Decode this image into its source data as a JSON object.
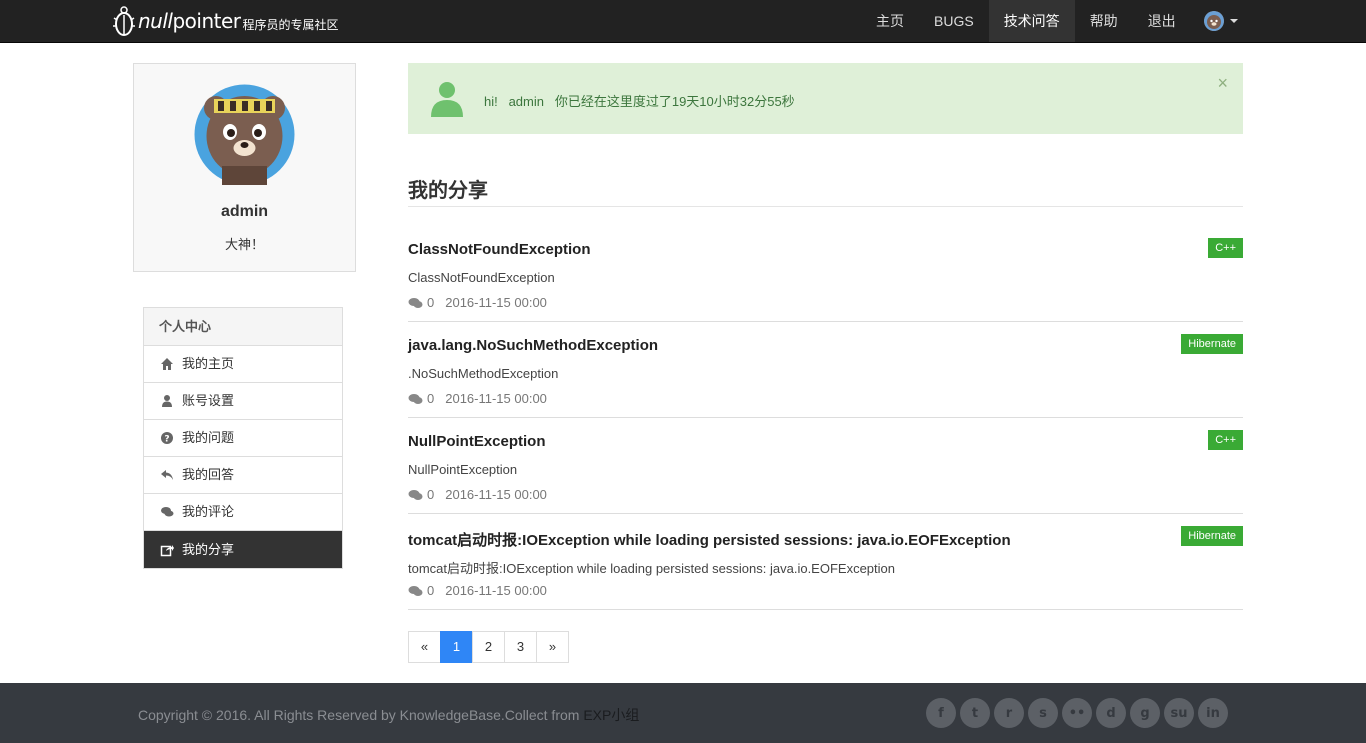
{
  "brand": {
    "name_italic": "null",
    "name_rest": "pointer",
    "subtitle": "程序员的专属社区"
  },
  "nav": {
    "items": [
      {
        "label": "主页",
        "active": false
      },
      {
        "label": "BUGS",
        "active": false
      },
      {
        "label": "技术问答",
        "active": true
      },
      {
        "label": "帮助",
        "active": false
      },
      {
        "label": "退出",
        "active": false
      }
    ]
  },
  "profile": {
    "name": "admin",
    "title": "大神！"
  },
  "side_menu": {
    "heading": "个人中心",
    "items": [
      {
        "label": "我的主页",
        "icon": "home-icon"
      },
      {
        "label": "账号设置",
        "icon": "user-icon"
      },
      {
        "label": "我的问题",
        "icon": "question-icon"
      },
      {
        "label": "我的回答",
        "icon": "reply-icon"
      },
      {
        "label": "我的评论",
        "icon": "comments-icon"
      },
      {
        "label": "我的分享",
        "icon": "share-icon",
        "active": true
      }
    ]
  },
  "alert": {
    "greeting": "hi!",
    "user": "admin",
    "message": "你已经在这里度过了19天10小时32分55秒",
    "close": "×"
  },
  "section": {
    "title": "我的分享"
  },
  "shares": [
    {
      "title": "ClassNotFoundException",
      "desc": "ClassNotFoundException",
      "comments": "0",
      "date": "2016-11-15 00:00",
      "tag": "C++"
    },
    {
      "title": "java.lang.NoSuchMethodException",
      "desc": ".NoSuchMethodException",
      "comments": "0",
      "date": "2016-11-15 00:00",
      "tag": "Hibernate"
    },
    {
      "title": "NullPointException",
      "desc": "NullPointException",
      "comments": "0",
      "date": "2016-11-15 00:00",
      "tag": "C++"
    },
    {
      "title": "tomcat启动时报:IOException while loading persisted sessions: java.io.EOFException",
      "desc": "tomcat启动时报:IOException while loading persisted sessions: java.io.EOFException",
      "comments": "0",
      "date": "2016-11-15 00:00",
      "tag": "Hibernate"
    }
  ],
  "pagination": {
    "prev": "«",
    "pages": [
      "1",
      "2",
      "3"
    ],
    "current": "1",
    "next": "»"
  },
  "footer": {
    "text": "Copyright © 2016. All Rights Reserved by KnowledgeBase.Collect from ",
    "link": "EXP小组",
    "social": [
      {
        "icon": "facebook-icon",
        "glyph": "f"
      },
      {
        "icon": "twitter-icon",
        "glyph": "t"
      },
      {
        "icon": "rss-icon",
        "glyph": "r"
      },
      {
        "icon": "skype-icon",
        "glyph": "s"
      },
      {
        "icon": "flickr-icon",
        "glyph": "••"
      },
      {
        "icon": "delicious-icon",
        "glyph": "d"
      },
      {
        "icon": "google-icon",
        "glyph": "g"
      },
      {
        "icon": "stumbleupon-icon",
        "glyph": "su"
      },
      {
        "icon": "linkedin-icon",
        "glyph": "in"
      }
    ]
  },
  "colors": {
    "navbar": "#222222",
    "alert_bg": "#dff0d8",
    "alert_text": "#3c763d",
    "tag": "#3aaa35",
    "page_active": "#2f86f6",
    "footer": "#363a40"
  }
}
